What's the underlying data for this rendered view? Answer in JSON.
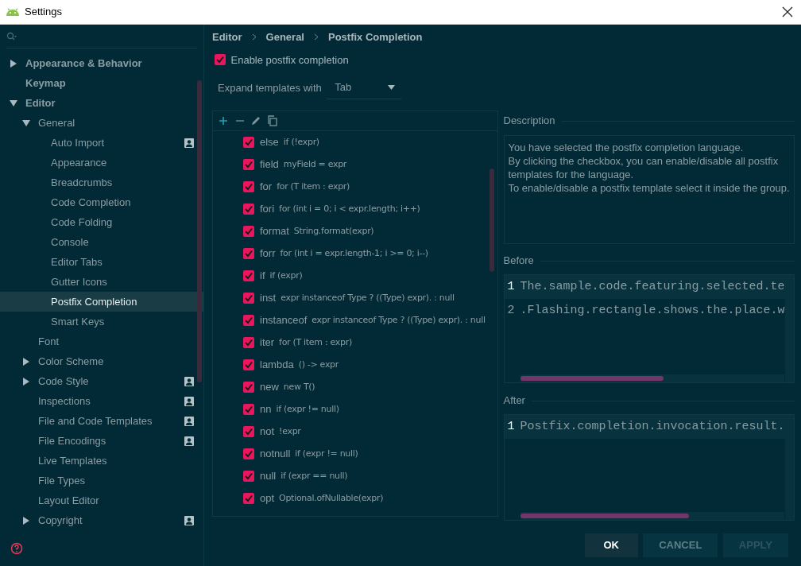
{
  "window": {
    "title": "Settings"
  },
  "sidebar": {
    "items": [
      {
        "label": "Appearance & Behavior",
        "expanded": false,
        "selected": false,
        "project_scope": false
      },
      {
        "label": "Keymap",
        "selected": false,
        "project_scope": false
      },
      {
        "label": "Editor",
        "expanded": true,
        "selected": false,
        "project_scope": false,
        "children": [
          {
            "label": "General",
            "expanded": true,
            "selected": false,
            "project_scope": false,
            "children": [
              {
                "label": "Auto Import",
                "selected": false,
                "project_scope": true
              },
              {
                "label": "Appearance",
                "selected": false,
                "project_scope": false
              },
              {
                "label": "Breadcrumbs",
                "selected": false,
                "project_scope": false
              },
              {
                "label": "Code Completion",
                "selected": false,
                "project_scope": false
              },
              {
                "label": "Code Folding",
                "selected": false,
                "project_scope": false
              },
              {
                "label": "Console",
                "selected": false,
                "project_scope": false
              },
              {
                "label": "Editor Tabs",
                "selected": false,
                "project_scope": false
              },
              {
                "label": "Gutter Icons",
                "selected": false,
                "project_scope": false
              },
              {
                "label": "Postfix Completion",
                "selected": true,
                "project_scope": false
              },
              {
                "label": "Smart Keys",
                "selected": false,
                "project_scope": false
              }
            ]
          },
          {
            "label": "Font",
            "selected": false,
            "project_scope": false
          },
          {
            "label": "Color Scheme",
            "expanded": false,
            "selected": false,
            "project_scope": false
          },
          {
            "label": "Code Style",
            "expanded": false,
            "selected": false,
            "project_scope": true
          },
          {
            "label": "Inspections",
            "selected": false,
            "project_scope": true
          },
          {
            "label": "File and Code Templates",
            "selected": false,
            "project_scope": true
          },
          {
            "label": "File Encodings",
            "selected": false,
            "project_scope": true
          },
          {
            "label": "Live Templates",
            "selected": false,
            "project_scope": false
          },
          {
            "label": "File Types",
            "selected": false,
            "project_scope": false
          },
          {
            "label": "Layout Editor",
            "selected": false,
            "project_scope": false
          },
          {
            "label": "Copyright",
            "expanded": false,
            "selected": false,
            "project_scope": true
          }
        ]
      }
    ]
  },
  "breadcrumb": [
    "Editor",
    "General",
    "Postfix Completion"
  ],
  "enable_postfix": {
    "label": "Enable postfix completion",
    "checked": true
  },
  "expand_with": {
    "label": "Expand templates with",
    "value": "Tab"
  },
  "templates": [
    {
      "key": "else",
      "example": "if (!expr)",
      "checked": true
    },
    {
      "key": "field",
      "example": "myField = expr",
      "checked": true
    },
    {
      "key": "for",
      "example": "for (T item : expr)",
      "checked": true
    },
    {
      "key": "fori",
      "example": "for (int i = 0; i < expr.length; i++)",
      "checked": true
    },
    {
      "key": "format",
      "example": "String.format(expr)",
      "checked": true
    },
    {
      "key": "forr",
      "example": "for (int i = expr.length-1; i >= 0; i--)",
      "checked": true
    },
    {
      "key": "if",
      "example": "if (expr)",
      "checked": true
    },
    {
      "key": "inst",
      "example": "expr instanceof Type ? ((Type) expr). : null",
      "checked": true
    },
    {
      "key": "instanceof",
      "example": "expr instanceof Type ? ((Type) expr). : null",
      "checked": true
    },
    {
      "key": "iter",
      "example": "for (T item : expr)",
      "checked": true
    },
    {
      "key": "lambda",
      "example": "() -> expr",
      "checked": true
    },
    {
      "key": "new",
      "example": "new T()",
      "checked": true
    },
    {
      "key": "nn",
      "example": "if (expr != null)",
      "checked": true
    },
    {
      "key": "not",
      "example": "!expr",
      "checked": true
    },
    {
      "key": "notnull",
      "example": "if (expr != null)",
      "checked": true
    },
    {
      "key": "null",
      "example": "if (expr == null)",
      "checked": true
    },
    {
      "key": "opt",
      "example": "Optional.ofNullable(expr)",
      "checked": true
    }
  ],
  "description": {
    "title": "Description",
    "paragraphs": [
      "You have selected the postfix completion language.",
      "By clicking the checkbox, you can enable/disable all postfix templates for the language.",
      "To enable/disable a postfix template select it inside the group."
    ]
  },
  "before": {
    "title": "Before",
    "lines": [
      {
        "number": "1",
        "text": "The.sample.code.featuring.selected.te",
        "current": true
      },
      {
        "number": "2",
        "text": ".Flashing.rectangle.shows.the.place.w",
        "current": false
      }
    ]
  },
  "after": {
    "title": "After",
    "lines": [
      {
        "number": "1",
        "text": "Postfix.completion.invocation.result.",
        "current": true
      }
    ]
  },
  "buttons": [
    {
      "label": "OK",
      "kind": "default",
      "disabled": false
    },
    {
      "label": "CANCEL",
      "kind": "normal",
      "disabled": false
    },
    {
      "label": "APPLY",
      "kind": "normal",
      "disabled": true
    }
  ]
}
